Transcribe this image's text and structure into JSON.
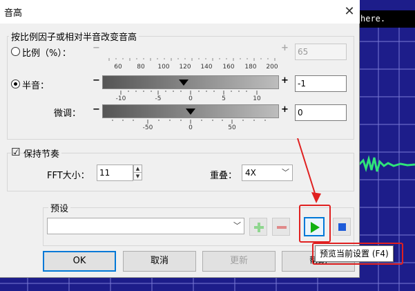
{
  "background": {
    "banner_text": "here."
  },
  "dialog": {
    "title": "音高",
    "close_glyph": "✕",
    "group_title": "按比例因子或相对半音改变音高",
    "ratio": {
      "label": "比例（%）：",
      "value": "65",
      "ticks": [
        "60",
        "80",
        "100",
        "120",
        "140",
        "160",
        "180",
        "200"
      ],
      "minus": "−",
      "plus": "+"
    },
    "semitone": {
      "label": "半音：",
      "value": "-1",
      "ticks": [
        "-10",
        "-5",
        "0",
        "5",
        "10"
      ],
      "minus": "−",
      "plus": "+"
    },
    "finetune": {
      "label": "微调：",
      "value": "0",
      "ticks": [
        "-50",
        "0",
        "50"
      ],
      "minus": "−",
      "plus": "+"
    },
    "keep_tempo": {
      "label": "保持节奏",
      "checked": "☑"
    },
    "fft": {
      "label": "FFT大小：",
      "value": "11"
    },
    "overlap": {
      "label": "重叠：",
      "value": "4X"
    },
    "preset": {
      "label": "预设",
      "value": ""
    },
    "buttons": {
      "ok": "OK",
      "cancel": "取消",
      "update": "更新",
      "help": "帮助"
    },
    "tooltip": "预览当前设置 (F4)"
  },
  "colors": {
    "accent": "#0078d7",
    "highlight": "#e02020",
    "play_green": "#10b010",
    "stop_blue": "#1e5bd8",
    "editor_bg": "#1d1d8a"
  }
}
